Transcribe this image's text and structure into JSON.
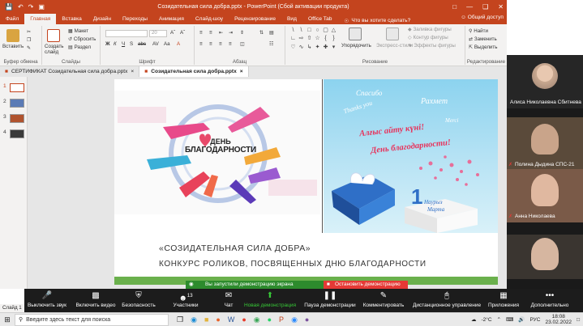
{
  "ppt": {
    "title": "Созидательная сила добра.pptx - PowerPoint (Сбой активации продукта)",
    "tabs": [
      "Файл",
      "Главная",
      "Вставка",
      "Дизайн",
      "Переходы",
      "Анимация",
      "Слайд-шоу",
      "Рецензирование",
      "Вид",
      "Office Tab"
    ],
    "tell_me": "Что вы хотите сделать?",
    "share": "Общий доступ",
    "ribbon": {
      "paste": "Вставить",
      "create_slide": "Создать слайд",
      "layout": "Макет",
      "reset": "Сбросить",
      "section": "Раздел",
      "groups": {
        "clipboard": "Буфер обмена",
        "slides": "Слайды",
        "font": "Шрифт",
        "paragraph": "Абзац",
        "drawing": "Рисование",
        "editing": "Редактирование"
      },
      "font_size": "20",
      "arrange": "Упорядочить",
      "quick_styles": "Экспресс-стили",
      "shape_fill": "Заливка фигуры",
      "shape_outline": "Контур фигуры",
      "shape_effects": "Эффекты фигуры",
      "find": "Найти",
      "replace": "Заменить",
      "select": "Выделить"
    },
    "file_tabs": [
      "СЕРТИФИКАТ Созидательная сила добра.pptx",
      "Созидательная сила добра.pptx"
    ],
    "slide_numbers": [
      "1",
      "2",
      "3",
      "4"
    ],
    "slide": {
      "badge_line1": "ДЕНЬ",
      "badge_line2": "БЛАГОДАРНОСТИ",
      "title": "«СОЗИДАТЕЛЬНАЯ СИЛА ДОБРА»",
      "subtitle": "КОНКУРС РОЛИКОВ, ПОСВЯЩЕННЫХ ДНЮ БЛАГОДАРНОСТИ",
      "words_top": [
        "Спасибо",
        "Thanks you",
        "Рахмет",
        "Merci"
      ],
      "kz_line": "Алғыс айту күні!",
      "ru_line": "День благодарности!",
      "date_day": "1",
      "date_text1": "Наурыз",
      "date_text2": "Марта"
    },
    "status": "Слайд 1"
  },
  "zoom": {
    "share_notice": "Вы запустили демонстрацию экрана",
    "stop_share": "Остановить демонстрацию",
    "participants": [
      {
        "name": "Алиса Николаевна Сбитнева"
      },
      {
        "name": "Полина Дыдина СПС-21"
      },
      {
        "name": "Анна Николаева"
      }
    ],
    "participants_count": "13",
    "toolbar": [
      {
        "label": "Выключить звук",
        "icon": "microphone-icon"
      },
      {
        "label": "Включить видео",
        "icon": "video-off-icon"
      },
      {
        "label": "Безопасность",
        "icon": "shield-icon"
      },
      {
        "label": "Участники",
        "icon": "participants-icon"
      },
      {
        "label": "Чат",
        "icon": "chat-icon"
      },
      {
        "label": "Новая демонстрация",
        "icon": "share-screen-icon"
      },
      {
        "label": "Пауза демонстрации",
        "icon": "pause-icon"
      },
      {
        "label": "Комментировать",
        "icon": "annotate-icon"
      },
      {
        "label": "Дистанционное управление",
        "icon": "remote-control-icon"
      },
      {
        "label": "Приложения",
        "icon": "apps-icon"
      },
      {
        "label": "Дополнительно",
        "icon": "more-icon"
      }
    ]
  },
  "taskbar": {
    "search_placeholder": "Введите здесь текст для поиска",
    "weather": "-2°C",
    "lang": "РУС",
    "time": "18:08",
    "date": "23.02.2022"
  }
}
